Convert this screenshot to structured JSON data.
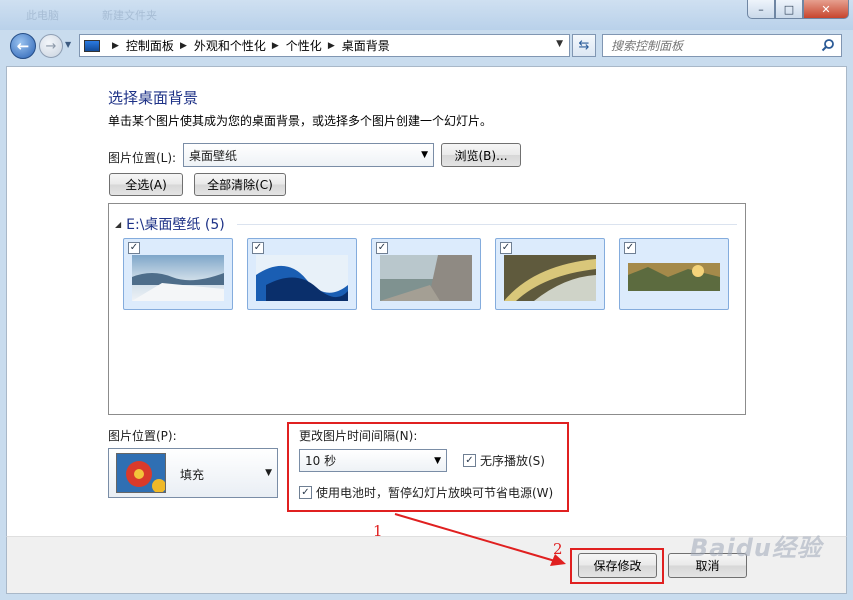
{
  "window": {
    "ghost_tab_1": "此电脑",
    "ghost_tab_2": "新建文件夹",
    "controls": {
      "minimize": "–",
      "maximize": "□",
      "close": "✕"
    }
  },
  "nav": {
    "back_icon": "back-arrow-icon",
    "forward_icon": "forward-arrow-icon",
    "breadcrumbs": [
      "控制面板",
      "外观和个性化",
      "个性化",
      "桌面背景"
    ],
    "search_placeholder": "搜索控制面板"
  },
  "main": {
    "heading": "选择桌面背景",
    "description": "单击某个图片使其成为您的桌面背景，或选择多个图片创建一个幻灯片。",
    "location_label": "图片位置(L):",
    "location_value": "桌面壁纸",
    "browse_label": "浏览(B)...",
    "select_all_label": "全选(A)",
    "clear_all_label": "全部清除(C)",
    "group_title": "E:\\桌面壁纸 (5)",
    "thumbnails": [
      {
        "checked": true,
        "name": "snow-mountain"
      },
      {
        "checked": true,
        "name": "blue-wave"
      },
      {
        "checked": true,
        "name": "seawall"
      },
      {
        "checked": true,
        "name": "gold-curve"
      },
      {
        "checked": true,
        "name": "mountain-sunrise"
      }
    ],
    "position_label": "图片位置(P):",
    "position_value": "填充",
    "interval_label": "更改图片时间间隔(N):",
    "interval_value": "10 秒",
    "shuffle_label": "无序播放(S)",
    "shuffle_checked": true,
    "battery_label": "使用电池时，暂停幻灯片放映可节省电源(W)",
    "battery_checked": true
  },
  "footer": {
    "save_label": "保存修改",
    "cancel_label": "取消"
  },
  "annotations": {
    "step1": "1",
    "step2": "2",
    "color": "#e02020"
  },
  "watermark": "Baidu经验"
}
